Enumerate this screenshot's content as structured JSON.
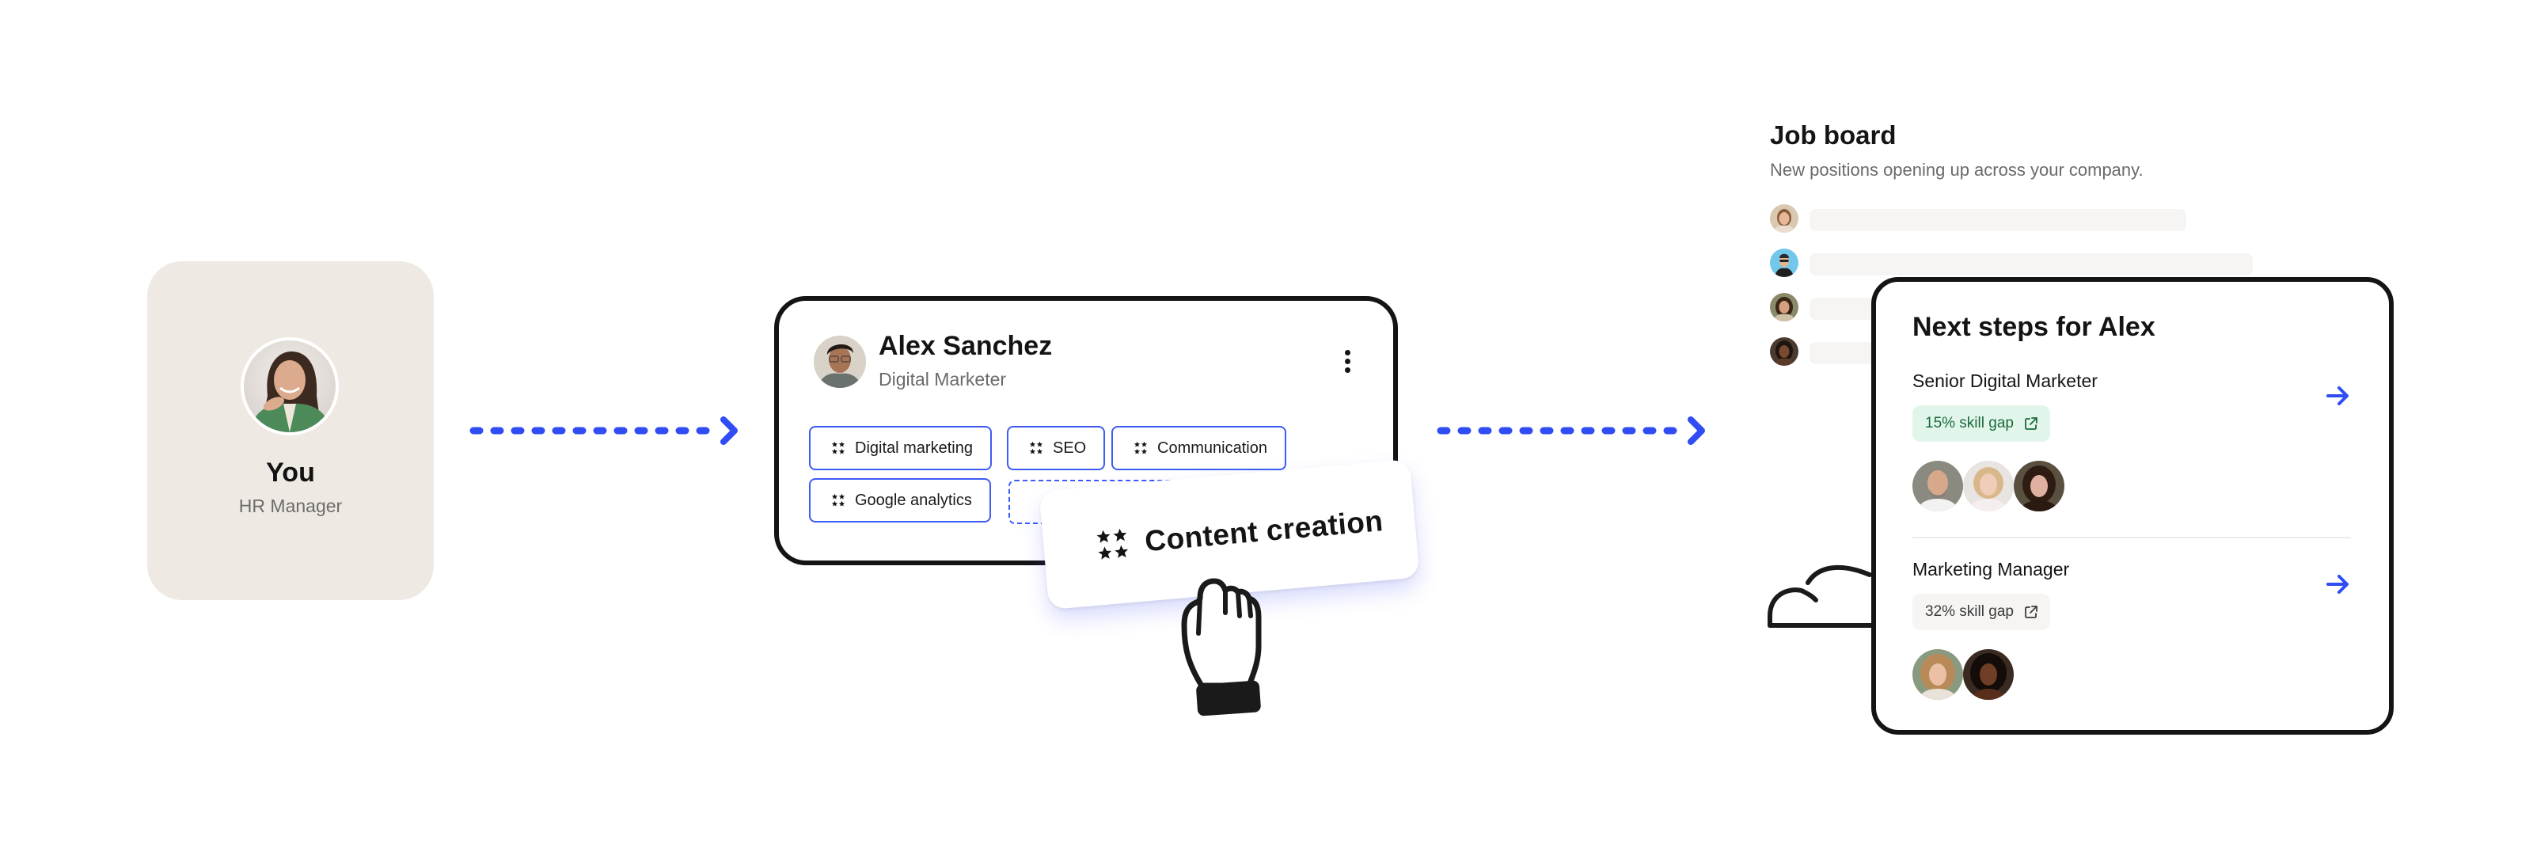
{
  "you": {
    "name": "You",
    "role": "HR Manager",
    "card_color": "#efe9e3",
    "avatar": "woman-green-blazer-avatar"
  },
  "flow": {
    "arrow_color": "#2f4cf5",
    "arrows": [
      "you-to-employee-arrow",
      "employee-to-jobs-arrow"
    ]
  },
  "employee": {
    "name": "Alex Sanchez",
    "role": "Digital Marketer",
    "menu_icon": "kebab-menu-icon",
    "skills": [
      {
        "label": "Digital marketing",
        "icon": "stars-icon"
      },
      {
        "label": "SEO",
        "icon": "stars-icon"
      },
      {
        "label": "Communication",
        "icon": "stars-icon"
      },
      {
        "label": "Google analytics",
        "icon": "stars-icon"
      }
    ],
    "dragged_skill": {
      "label": "Content creation",
      "icon": "stars-icon"
    },
    "drag_cursor": "grab-hand-icon"
  },
  "job_board": {
    "title": "Job board",
    "subtitle": "New positions opening up across your company.",
    "rows": [
      {
        "avatar": "woman-light-hair-avatar"
      },
      {
        "avatar": "man-glasses-blue-bg-avatar"
      },
      {
        "avatar": "woman-dark-curly-hair-avatar"
      },
      {
        "avatar": "woman-dark-skin-avatar"
      }
    ]
  },
  "next_steps": {
    "title": "Next steps for Alex",
    "positions": [
      {
        "title": "Senior Digital Marketer",
        "skill_gap": "15% skill gap",
        "gap_status": "good",
        "gap_color": "#1a6a3c",
        "people": [
          "bald-man-beard-avatar",
          "blonde-woman-avatar",
          "brunette-woman-avatar"
        ]
      },
      {
        "title": "Marketing Manager",
        "skill_gap": "32% skill gap",
        "gap_status": "neutral",
        "gap_color": "#3c3c3c",
        "people": [
          "curly-blonde-woman-avatar",
          "dark-haired-woman-avatar"
        ]
      }
    ],
    "go_icon": "arrow-right-icon",
    "external_icon": "external-link-icon"
  }
}
